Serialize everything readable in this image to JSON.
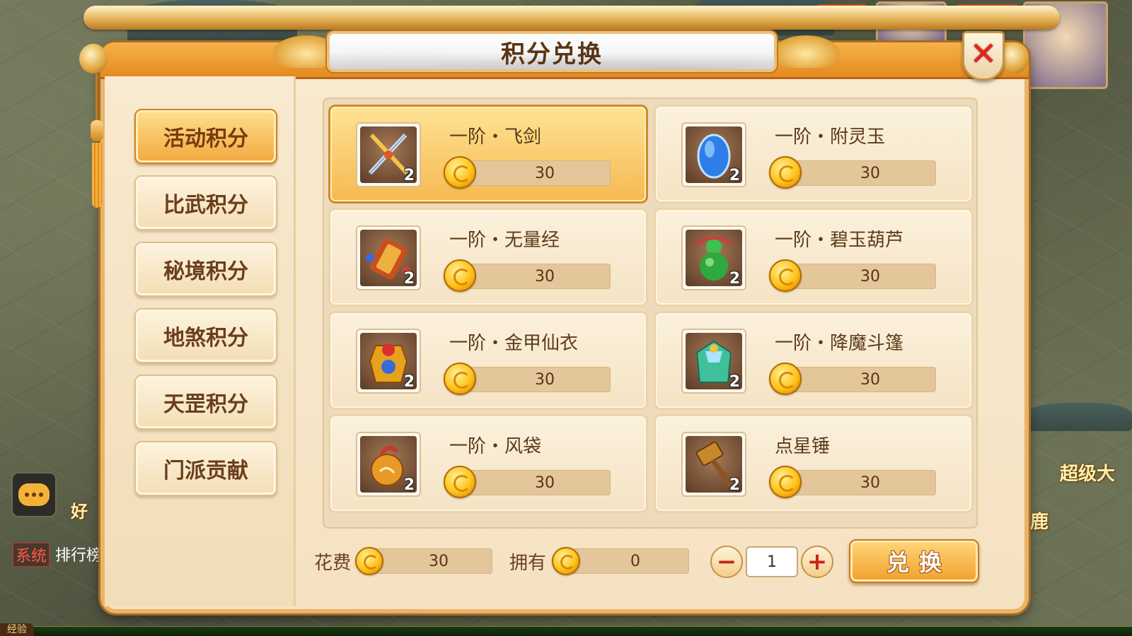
{
  "dialog": {
    "title": "积分兑换",
    "close_symbol": "✕"
  },
  "nav": {
    "tabs": [
      {
        "label": "活动积分",
        "active": true
      },
      {
        "label": "比武积分",
        "active": false
      },
      {
        "label": "秘境积分",
        "active": false
      },
      {
        "label": "地煞积分",
        "active": false
      },
      {
        "label": "天罡积分",
        "active": false
      },
      {
        "label": "门派贡献",
        "active": false
      }
    ]
  },
  "items": [
    {
      "name": "一阶・飞剑",
      "count": "2",
      "price": "30",
      "icon": "flying-sword-icon",
      "selected": true
    },
    {
      "name": "一阶・附灵玉",
      "count": "2",
      "price": "30",
      "icon": "spirit-jade-icon",
      "selected": false
    },
    {
      "name": "一阶・无量经",
      "count": "2",
      "price": "30",
      "icon": "sutra-scroll-icon",
      "selected": false
    },
    {
      "name": "一阶・碧玉葫芦",
      "count": "2",
      "price": "30",
      "icon": "jade-gourd-icon",
      "selected": false
    },
    {
      "name": "一阶・金甲仙衣",
      "count": "2",
      "price": "30",
      "icon": "golden-armor-icon",
      "selected": false
    },
    {
      "name": "一阶・降魔斗篷",
      "count": "2",
      "price": "30",
      "icon": "demon-cloak-icon",
      "selected": false
    },
    {
      "name": "一阶・风袋",
      "count": "2",
      "price": "30",
      "icon": "wind-bag-icon",
      "selected": false
    },
    {
      "name": "点星锤",
      "count": "2",
      "price": "30",
      "icon": "star-hammer-icon",
      "selected": false
    }
  ],
  "footer": {
    "cost_label": "花费",
    "cost_value": "30",
    "owned_label": "拥有",
    "owned_value": "0",
    "minus_symbol": "−",
    "plus_symbol": "+",
    "quantity": "1",
    "exchange_label": "兑换"
  },
  "background": {
    "system_tag": "系统",
    "system_text": "排行榜",
    "hud_text": "超级大",
    "hud_text_2": "色鹿",
    "chat_snippet": "好",
    "exp_label": "经验"
  },
  "colors": {
    "accent": "#f2a840",
    "selected_card": "#f5b950",
    "close_red": "#e4261b",
    "coin_gold": "#ffc21a"
  }
}
